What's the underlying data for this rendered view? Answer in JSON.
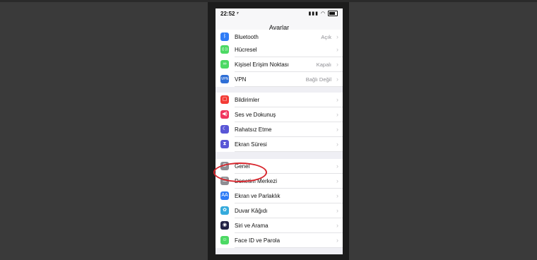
{
  "status": {
    "time": "22:52 ⁷",
    "icons": "▮▮▮ ◠"
  },
  "nav": {
    "title": "Ayarlar"
  },
  "rows": [
    {
      "label": "Bluetooth",
      "value": "Açık",
      "icon": "bluetooth-icon",
      "color": "#2f7cf6",
      "glyph": "ᛒ"
    },
    {
      "label": "Hücresel",
      "value": "",
      "icon": "cellular-icon",
      "color": "#4cd964",
      "glyph": "((·))"
    },
    {
      "label": "Kişisel Erişim Noktası",
      "value": "Kapalı",
      "icon": "hotspot-icon",
      "color": "#4cd964",
      "glyph": "∞"
    },
    {
      "label": "VPN",
      "value": "Bağlı Değil",
      "icon": "vpn-icon",
      "color": "#2f6fd6",
      "glyph": "VPN"
    },
    {
      "label": "Bildirimler",
      "value": "",
      "icon": "notifications-icon",
      "color": "#f33b35",
      "glyph": "▢"
    },
    {
      "label": "Ses ve Dokunuş",
      "value": "",
      "icon": "sound-icon",
      "color": "#f0355e",
      "glyph": "◀)"
    },
    {
      "label": "Rahatsız Etme",
      "value": "",
      "icon": "moon-icon",
      "color": "#5956d6",
      "glyph": "☾"
    },
    {
      "label": "Ekran Süresi",
      "value": "",
      "icon": "hourglass-icon",
      "color": "#5956d6",
      "glyph": "⧗"
    },
    {
      "label": "Genel",
      "value": "",
      "icon": "gear-icon",
      "color": "#8e8e93",
      "glyph": "⚙"
    },
    {
      "label": "Denetim Merkezi",
      "value": "",
      "icon": "control-center-icon",
      "color": "#8e8e93",
      "glyph": "☰"
    },
    {
      "label": "Ekran ve Parlaklık",
      "value": "",
      "icon": "display-icon",
      "color": "#2f7cf6",
      "glyph": "AA"
    },
    {
      "label": "Duvar Kâğıdı",
      "value": "",
      "icon": "wallpaper-icon",
      "color": "#35aadc",
      "glyph": "✿"
    },
    {
      "label": "Siri ve Arama",
      "value": "",
      "icon": "siri-icon",
      "color": "#222244",
      "glyph": "◉"
    },
    {
      "label": "Face ID ve Parola",
      "value": "",
      "icon": "faceid-icon",
      "color": "#4cd964",
      "glyph": "☺"
    }
  ],
  "chevron": "›",
  "annotation_color": "#d8262d"
}
